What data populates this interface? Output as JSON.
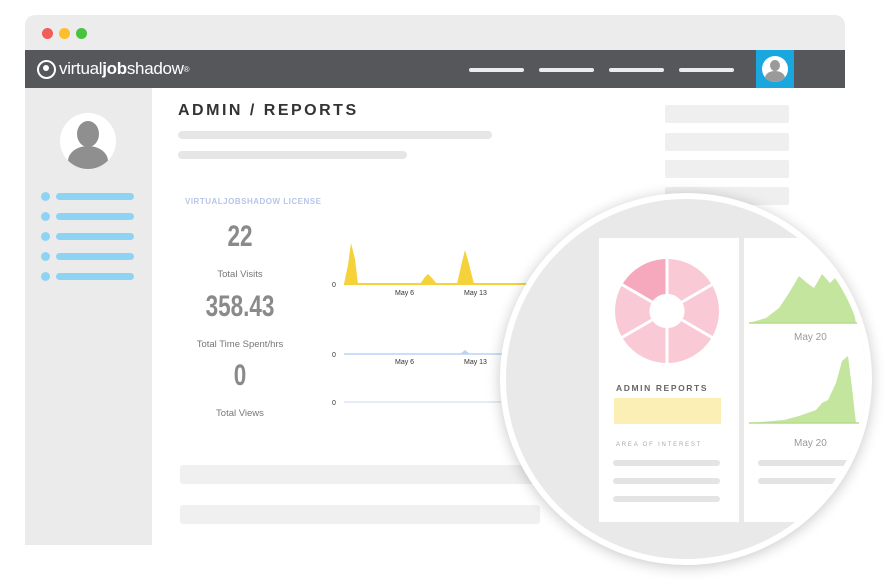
{
  "app": {
    "logo_text_regular": "virtual",
    "logo_text_bold": "job",
    "logo_text_end": "shadow",
    "logo_mark": "®"
  },
  "window_controls": {
    "colors": {
      "close": "#f25d57",
      "minimize": "#fbbf2d",
      "maximize": "#45c53e"
    }
  },
  "page": {
    "title": "ADMIN / REPORTS",
    "license_label": "VIRTUALJOBSHADOW LICENSE"
  },
  "stats": [
    {
      "value": "22",
      "label": "Total Visits"
    },
    {
      "value": "358.43",
      "label": "Total Time Spent/hrs"
    },
    {
      "value": "0",
      "label": "Total Views"
    }
  ],
  "charts": {
    "y_zero_label": "0",
    "x_ticks": [
      "May 6",
      "May 13"
    ],
    "colors": {
      "visits": "#f5d13a",
      "time": "#bcd3f2",
      "views": "#c9d8f3"
    }
  },
  "magnified": {
    "title": "ADMIN REPORTS",
    "subtitle": "AREA OF INTEREST",
    "dates": [
      "May 20",
      "May 20"
    ],
    "colors": {
      "pie": "#f9c9d5",
      "pie_highlight": "#f6a9bd",
      "area": "#c3e59e",
      "highlight": "#fbefb6"
    }
  }
}
